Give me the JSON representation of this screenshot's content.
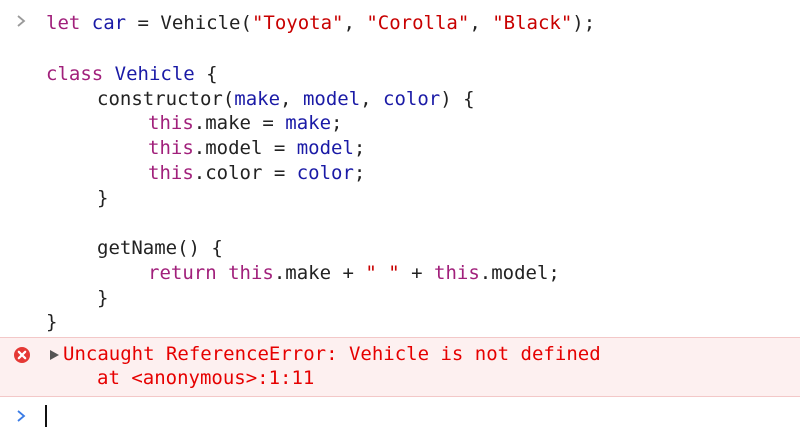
{
  "colors": {
    "keyword": "#a1207b",
    "string": "#c80000",
    "variable": "#1a1aa6",
    "error_text": "#e60000",
    "error_bg": "#fdf0f0",
    "input_chevron": "#3b7ce6"
  },
  "input": {
    "prefix_kw": "let",
    "prefix_var": "car",
    "assign": " = Vehicle(",
    "arg1": "\"Toyota\"",
    "comma1": ", ",
    "arg2": "\"Corolla\"",
    "comma2": ", ",
    "arg3": "\"Black\"",
    "end": ");",
    "class_kw": "class",
    "class_name": "Vehicle",
    "class_open": " {",
    "ctor_name": "constructor(",
    "p_make": "make",
    "p_sep1": ", ",
    "p_model": "model",
    "p_sep2": ", ",
    "p_color": "color",
    "ctor_open": ") {",
    "this_kw": "this",
    "make_assign": ".make = ",
    "make_val": "make",
    "semi": ";",
    "model_assign": ".model = ",
    "model_val": "model",
    "color_assign": ".color = ",
    "color_val": "color",
    "close_brace": "}",
    "getname": "getName() {",
    "return_kw": "return",
    "ret_this1": "this",
    "ret_make": ".make + ",
    "ret_space": "\" \"",
    "ret_plus": " + ",
    "ret_this2": "this",
    "ret_model": ".model;"
  },
  "error": {
    "message": "Uncaught ReferenceError: Vehicle is not defined",
    "location": "at <anonymous>:1:11"
  }
}
